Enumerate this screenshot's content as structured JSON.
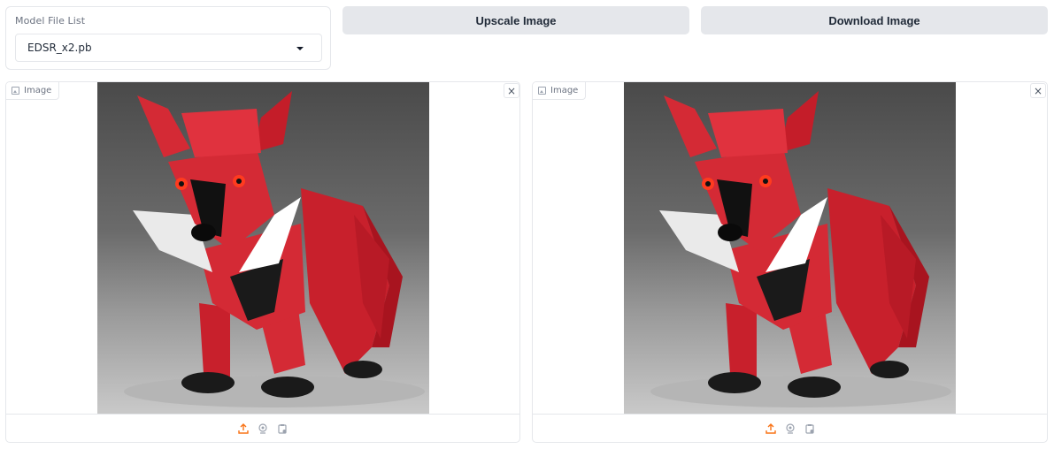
{
  "model": {
    "label": "Model File List",
    "selected": "EDSR_x2.pb"
  },
  "buttons": {
    "upscale": "Upscale Image",
    "download": "Download Image"
  },
  "panels": {
    "left": {
      "tag": "Image",
      "close": "×"
    },
    "right": {
      "tag": "Image",
      "close": "×"
    }
  },
  "icons": {
    "tag": "image-icon",
    "close": "close-icon",
    "upload": "upload-icon",
    "webcam": "webcam-icon",
    "clipboard": "clipboard-icon",
    "dropdown": "chevron-down-icon"
  },
  "colors": {
    "accent": "#f97316",
    "button_bg": "#e5e7eb",
    "border": "#e5e7eb",
    "muted_icon": "#9ca3af",
    "origami_red": "#d42a35"
  }
}
